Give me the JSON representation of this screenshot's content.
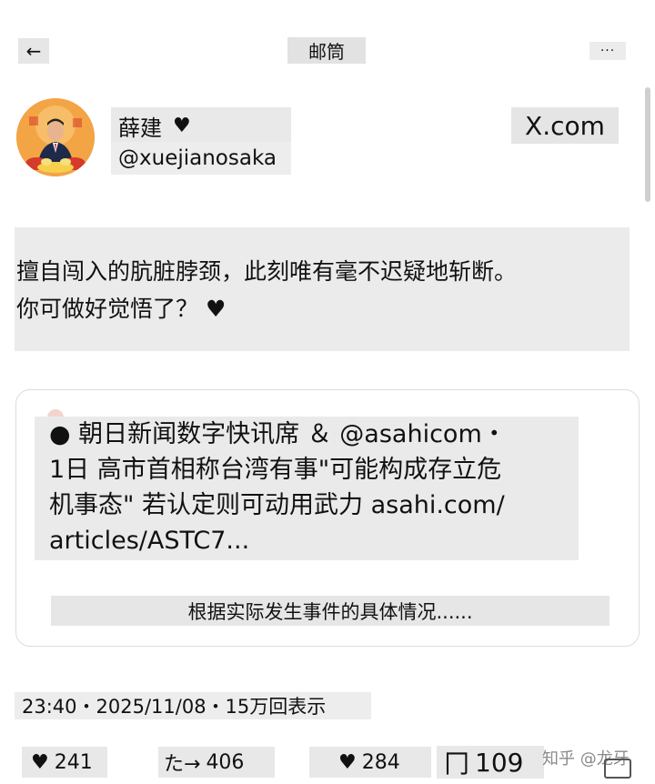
{
  "nav": {
    "back_icon": "←",
    "title": "邮筒",
    "more_icon": "···"
  },
  "author": {
    "name": "薛建",
    "name_heart": "♥",
    "handle": "@xuejianosaka",
    "source": "X.com"
  },
  "post": {
    "lines": [
      "擅自闯入的肮脏脖颈，此刻唯有毫不迟疑地斩断。",
      "你可做好觉悟了？ ♥"
    ]
  },
  "quote": {
    "lines": [
      "● 朝日新闻数字快讯席 ＆ @asahicom・",
      "1日 高市首相称台湾有事\"可能构成存立危",
      "机事态\" 若认定则可动用武力 asahi.com/",
      "articles/ASTC7..."
    ],
    "summary": "根据实际发生事件的具体情况......"
  },
  "meta": {
    "text": "23:40・2025/11/08・15万回表示"
  },
  "actions": {
    "like_icon": "♥",
    "like_count": "241",
    "repost_label": "た→",
    "repost_count": "406",
    "heart_icon": "♥",
    "heart_count": "284",
    "bookmark_icon": "冂",
    "bookmark_count": "109"
  },
  "watermark": "知乎 @龙牙",
  "colors": {
    "redaction_gray": "#e8e8e8",
    "avatar_orange": "#f1a13a"
  }
}
